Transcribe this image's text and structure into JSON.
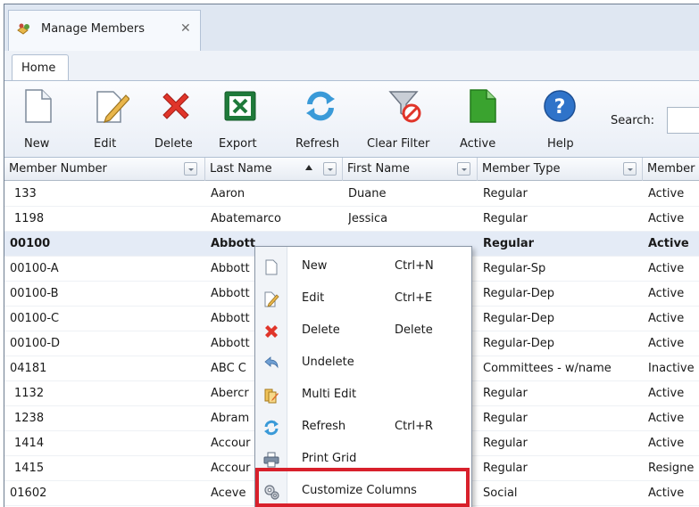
{
  "window": {
    "tab_title": "Manage Members",
    "close_glyph": "✕"
  },
  "ribbon": {
    "page_tab": "Home",
    "buttons": [
      {
        "label": "New",
        "icon": "new-document-icon"
      },
      {
        "label": "Edit",
        "icon": "edit-pencil-icon"
      },
      {
        "label": "Delete",
        "icon": "delete-x-icon"
      },
      {
        "label": "Export",
        "icon": "excel-export-icon"
      },
      {
        "label": "Refresh",
        "icon": "refresh-icon"
      },
      {
        "label": "Clear Filter",
        "icon": "clear-filter-icon"
      },
      {
        "label": "Active",
        "icon": "active-document-icon"
      },
      {
        "label": "Help",
        "icon": "help-icon"
      }
    ],
    "search_label": "Search:",
    "search_value": "",
    "colors": {
      "delete": "#e0352a",
      "excel": "#1f7a3a",
      "active": "#3aa32f",
      "help": "#2f73c9",
      "refresh": "#3a9ad8"
    }
  },
  "grid": {
    "columns": [
      "Member Number",
      "Last Name",
      "First Name",
      "Member Type",
      "Member"
    ],
    "sort": {
      "column": "Last Name",
      "direction": "ascending"
    },
    "rows": [
      [
        "133",
        "Aaron",
        "Duane",
        "Regular",
        "Active"
      ],
      [
        "1198",
        "Abatemarco",
        "Jessica",
        "Regular",
        "Active"
      ],
      [
        "00100",
        "Abbott",
        "",
        "Regular",
        "Active"
      ],
      [
        "00100-A",
        "Abbott",
        "",
        "Regular-Sp",
        "Active"
      ],
      [
        "00100-B",
        "Abbott",
        "",
        "Regular-Dep",
        "Active"
      ],
      [
        "00100-C",
        "Abbott",
        "",
        "Regular-Dep",
        "Active"
      ],
      [
        "00100-D",
        "Abbott",
        "",
        "Regular-Dep",
        "Active"
      ],
      [
        "04181",
        "ABC C",
        "",
        "Committees - w/name",
        "Inactive"
      ],
      [
        "1132",
        "Abercr",
        "",
        "Regular",
        "Active"
      ],
      [
        "1238",
        "Abram",
        "",
        "Regular",
        "Active"
      ],
      [
        "1414",
        "Accour",
        "",
        "Regular",
        "Active"
      ],
      [
        "1415",
        "Accour",
        "",
        "Regular",
        "Resigne"
      ],
      [
        "01602",
        "Aceve",
        "",
        "Social",
        "Active"
      ]
    ],
    "selected_row": 2
  },
  "context_menu": {
    "items": [
      {
        "label": "New",
        "shortcut": "Ctrl+N",
        "icon": "new-document-icon"
      },
      {
        "label": "Edit",
        "shortcut": "Ctrl+E",
        "icon": "edit-pencil-icon"
      },
      {
        "label": "Delete",
        "shortcut": "Delete",
        "icon": "delete-x-icon"
      },
      {
        "label": "Undelete",
        "shortcut": "",
        "icon": "undo-arrow-icon"
      },
      {
        "label": "Multi Edit",
        "shortcut": "",
        "icon": "multi-edit-icon"
      },
      {
        "label": "Refresh",
        "shortcut": "Ctrl+R",
        "icon": "refresh-icon"
      },
      {
        "label": "Print Grid",
        "shortcut": "",
        "icon": "printer-icon"
      },
      {
        "label": "Customize Columns",
        "shortcut": "",
        "icon": "gears-icon"
      }
    ],
    "highlighted_item": "Customize Columns",
    "highlight_color": "#d8202b"
  }
}
